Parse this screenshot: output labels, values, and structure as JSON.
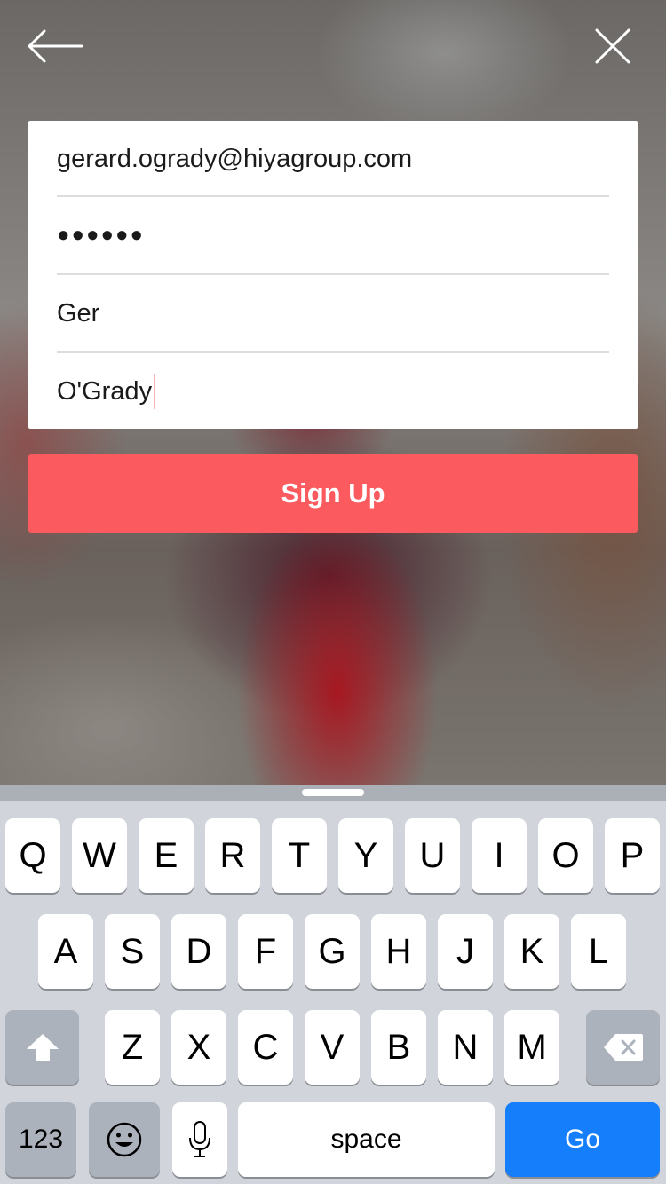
{
  "header": {
    "back_icon": "arrow-left-icon",
    "close_icon": "close-x-icon"
  },
  "form": {
    "email_value": "gerard.ogrady@hiyagroup.com",
    "password_value": "●●●●●●",
    "first_name_value": "Ger",
    "last_name_value": "O'Grady"
  },
  "signup_button": {
    "label": "Sign Up",
    "color": "#fb5b5e"
  },
  "keyboard": {
    "row1": [
      "Q",
      "W",
      "E",
      "R",
      "T",
      "Y",
      "U",
      "I",
      "O",
      "P"
    ],
    "row2": [
      "A",
      "S",
      "D",
      "F",
      "G",
      "H",
      "J",
      "K",
      "L"
    ],
    "row3": [
      "Z",
      "X",
      "C",
      "V",
      "B",
      "N",
      "M"
    ],
    "numbers_label": "123",
    "space_label": "space",
    "go_label": "Go",
    "go_color": "#147efb",
    "shift_icon": "shift-arrow-icon",
    "delete_icon": "backspace-icon",
    "emoji_icon": "emoji-icon",
    "mic_icon": "microphone-icon"
  }
}
